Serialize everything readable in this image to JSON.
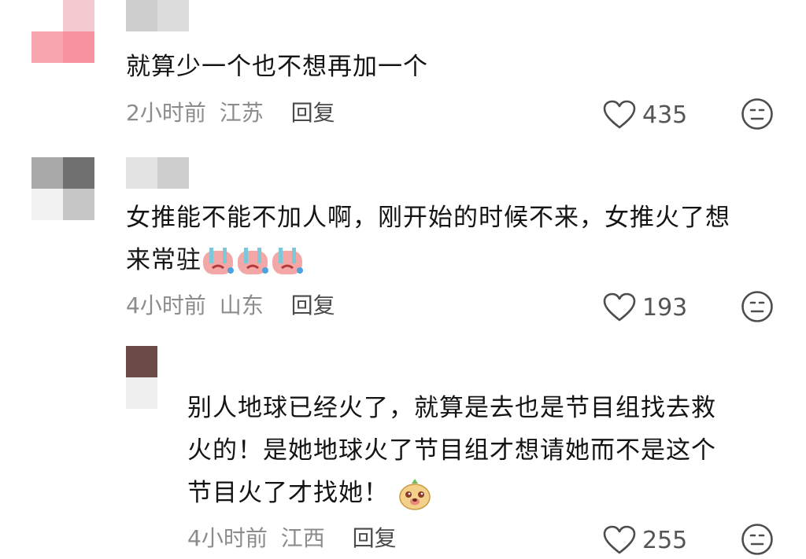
{
  "comments": [
    {
      "text": "就算少一个也不想再加一个",
      "time": "2小时前",
      "location": "江苏",
      "reply_label": "回复",
      "likes": "435"
    },
    {
      "text_line1": "女推能不能不加人啊，刚开始的时候不来，女推火了想",
      "text_line2": "来常驻",
      "time": "4小时前",
      "location": "山东",
      "reply_label": "回复",
      "likes": "193"
    }
  ],
  "reply": {
    "line1": "别人地球已经火了，就算是去也是节目组找去救",
    "line2": "火的！是她地球火了节目组才想请她而不是这个",
    "line3": "节目火了才找她！",
    "time": "4小时前",
    "location": "江西",
    "reply_label": "回复",
    "likes": "255"
  },
  "icons": {
    "like": "heart-outline-icon",
    "dislike": "neutral-face-icon",
    "emoji_crying": "crying-face-emoji",
    "emoji_dog": "dog-face-emoji"
  },
  "colors": {
    "text": "#141414",
    "meta": "#8c8c8c",
    "reply_label": "#4a4a4a",
    "icon": "#4d4d4d"
  }
}
